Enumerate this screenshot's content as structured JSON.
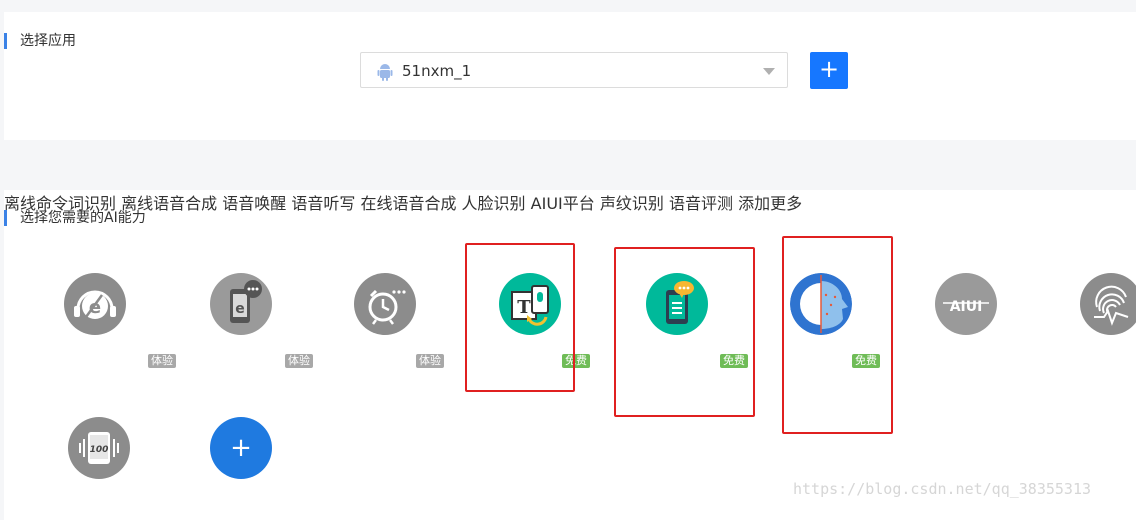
{
  "app_section": {
    "title": "选择应用",
    "selected_app": "51nxm_1",
    "add_label": "+"
  },
  "ai_section": {
    "title": "选择您需要的AI能力",
    "items": [
      {
        "label": "离线命令词识别",
        "badge": "体验",
        "icon": "offline-command-icon"
      },
      {
        "label": "离线语音合成",
        "badge": "体验",
        "icon": "offline-tts-icon"
      },
      {
        "label": "语音唤醒",
        "badge": "体验",
        "icon": "alarm-clock-icon"
      },
      {
        "label": "语音听写",
        "badge": "免费",
        "icon": "dictation-icon"
      },
      {
        "label": "在线语音合成",
        "badge": "免费",
        "icon": "online-tts-icon"
      },
      {
        "label": "人脸识别",
        "badge": "免费",
        "icon": "face-recognition-icon"
      },
      {
        "label": "AIUI平台",
        "badge": "",
        "icon": "aiui-icon"
      },
      {
        "label": "声纹识别",
        "badge": "",
        "icon": "voiceprint-icon"
      },
      {
        "label": "语音评测",
        "badge": "",
        "icon": "speech-evaluation-icon"
      },
      {
        "label": "添加更多",
        "badge": "",
        "icon": "plus-icon",
        "symbol": "+"
      }
    ]
  },
  "watermark": "https://blog.csdn.net/qq_38355313",
  "colors": {
    "accent_blue": "#1677ff",
    "teal": "#00b99a",
    "icon_gray": "#8c8c8c",
    "free_badge": "#6fbc57",
    "trial_badge": "#a8a8a8",
    "highlight_red": "#e02020"
  }
}
